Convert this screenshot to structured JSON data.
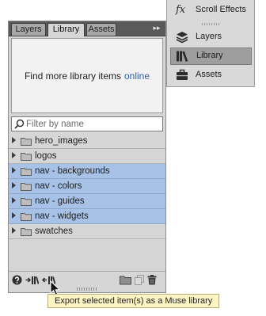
{
  "tabs": {
    "layers_label": "Layers",
    "library_label": "Library",
    "assets_label": "Assets",
    "active": "Library",
    "panel_menu_glyph": "▸▸"
  },
  "promo": {
    "text": "Find more library items",
    "link_text": "online",
    "link_color": "#2f5fa8"
  },
  "search": {
    "placeholder": "Filter by name",
    "value": ""
  },
  "library_items": [
    {
      "label": "hero_images",
      "selected": false
    },
    {
      "label": "logos",
      "selected": false
    },
    {
      "label": "nav - backgrounds",
      "selected": true
    },
    {
      "label": "nav - colors",
      "selected": true
    },
    {
      "label": "nav - guides",
      "selected": true
    },
    {
      "label": "nav - widgets",
      "selected": true
    },
    {
      "label": "swatches",
      "selected": false
    }
  ],
  "footer": {
    "left_icons": [
      "help-icon",
      "import-library-icon",
      "export-library-icon"
    ],
    "right_icons": [
      "new-folder-icon",
      "new-item-icon",
      "trash-icon"
    ]
  },
  "side_panel": {
    "items": [
      {
        "label": "Scroll Effects",
        "icon": "fx-icon",
        "active": false
      },
      {
        "label": "Layers",
        "icon": "layers-icon",
        "active": false
      },
      {
        "label": "Library",
        "icon": "library-icon",
        "active": true
      },
      {
        "label": "Assets",
        "icon": "assets-icon",
        "active": false
      }
    ],
    "fx_glyph": "fx"
  },
  "tooltip": {
    "text": "Export selected item(s) as a Muse library"
  },
  "colors": {
    "selection": "#a7c2e6",
    "panel": "#d6d6d6",
    "tooltip": "#fdf5c4"
  }
}
